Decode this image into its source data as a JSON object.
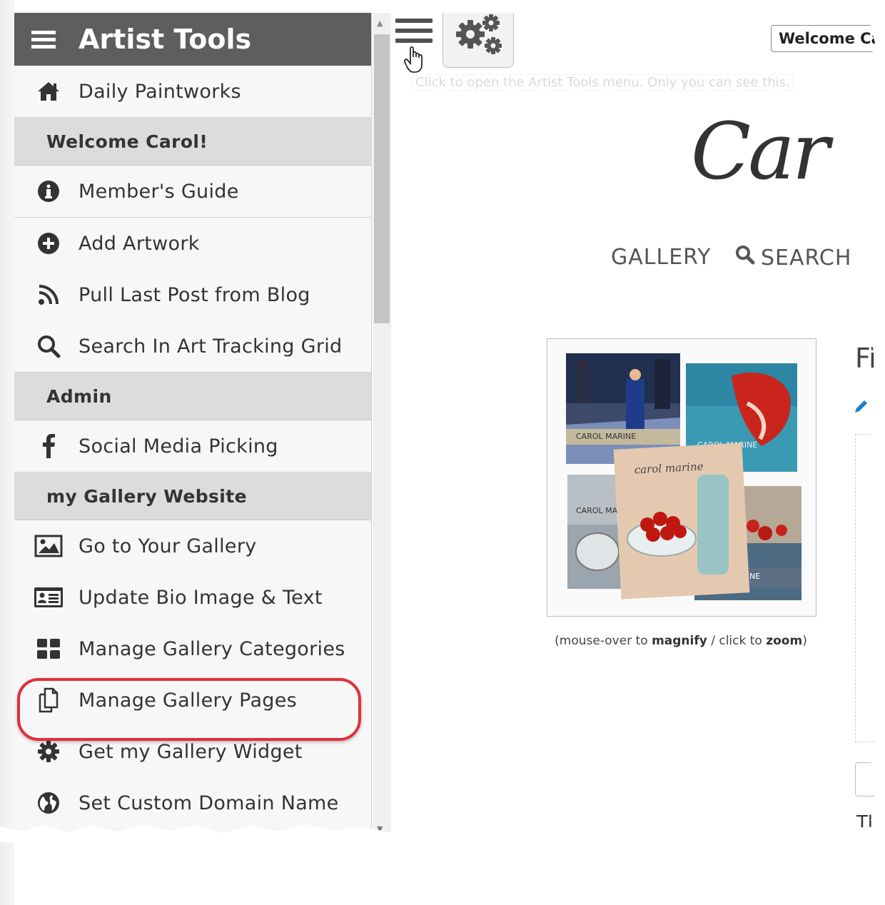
{
  "sidebar": {
    "title": "Artist Tools",
    "items": [
      {
        "label": "Daily Paintworks",
        "icon": "home-icon"
      },
      {
        "label": "Member's Guide",
        "icon": "info-icon"
      },
      {
        "label": "Add Artwork",
        "icon": "plus-circle-icon"
      },
      {
        "label": "Pull Last Post from Blog",
        "icon": "rss-icon"
      },
      {
        "label": "Search In Art Tracking Grid",
        "icon": "search-icon"
      },
      {
        "label": "Social Media Picking",
        "icon": "facebook-icon"
      },
      {
        "label": "Go to Your Gallery",
        "icon": "image-icon"
      },
      {
        "label": "Update Bio Image & Text",
        "icon": "id-card-icon"
      },
      {
        "label": "Manage Gallery Categories",
        "icon": "grid-icon"
      },
      {
        "label": "Manage Gallery Pages",
        "icon": "copy-pages-icon"
      },
      {
        "label": "Get my Gallery Widget",
        "icon": "gear-icon"
      },
      {
        "label": "Set Custom Domain Name",
        "icon": "globe-icon"
      }
    ],
    "sections": {
      "welcome": "Welcome Carol!",
      "admin": "Admin",
      "gallery": "my Gallery Website"
    }
  },
  "page": {
    "tooltip": "Click to open the Artist Tools menu. Only you can see this.",
    "welcome_button": "Welcome Ca",
    "logo_text": "Car",
    "nav_gallery": "GALLERY",
    "nav_search": "SEARCH",
    "caption_prefix": "(mouse-over to ",
    "caption_magnify": "magnify",
    "caption_mid": " / click to ",
    "caption_zoom": "zoom",
    "caption_suffix": ")",
    "heading_fragment": "Fi",
    "bottom_fragment": "Th",
    "artwork_texts": {
      "book1": "CAROL MARINE",
      "book2": "CAROL MARINE",
      "book3": "carol marine",
      "book4": "CAROL MARINE",
      "book5": "CAROL MARINE"
    }
  },
  "colors": {
    "header_bg": "#5e5e5e",
    "section_bg": "#dcdcdc",
    "highlight": "#e0303a",
    "accent_blue": "#1a7fcf"
  }
}
